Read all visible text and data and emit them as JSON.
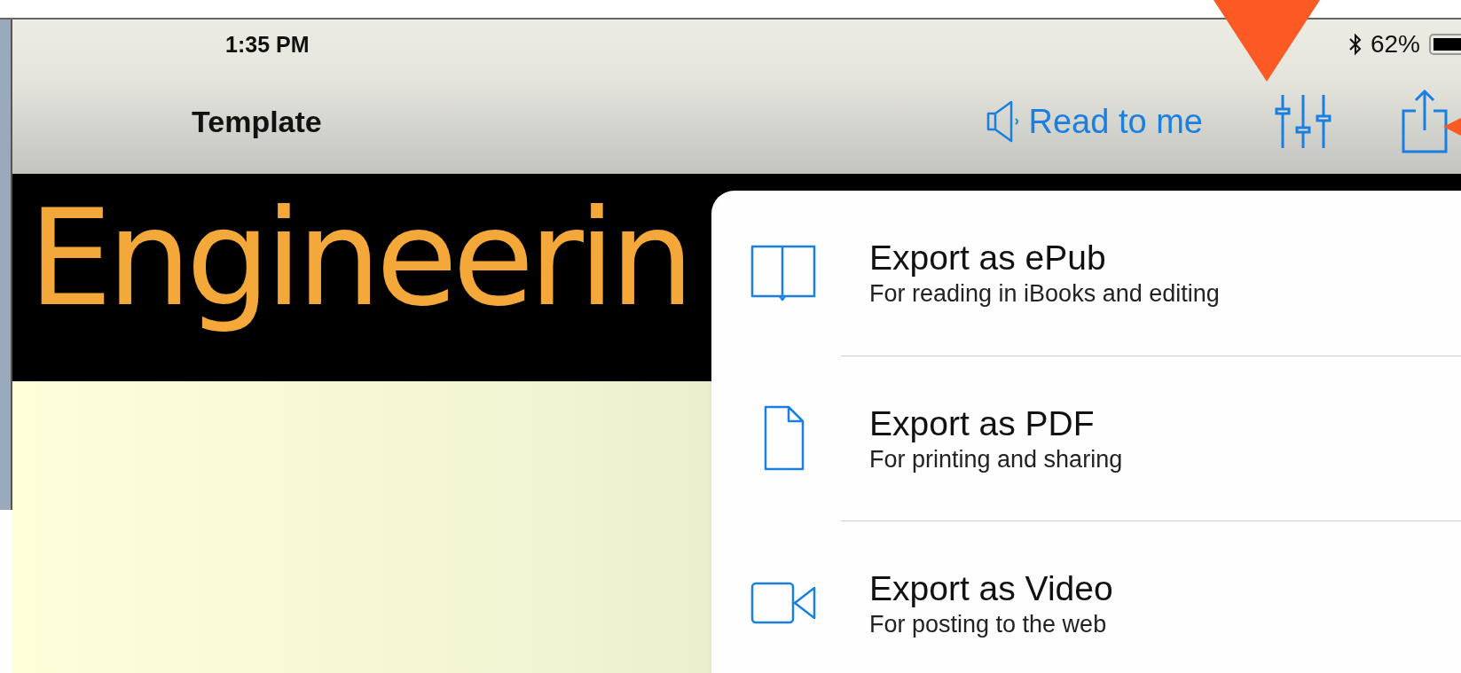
{
  "status_bar": {
    "time": "1:35 PM",
    "battery": "62%"
  },
  "nav_bar": {
    "title": "Template",
    "read_button": "Read to me"
  },
  "banner": {
    "title": "Engineerin"
  },
  "export_menu": {
    "items": [
      {
        "kind": "epub",
        "title": "Export as ePub",
        "subtitle": "For reading in iBooks and editing"
      },
      {
        "kind": "pdf",
        "title": "Export as PDF",
        "subtitle": "For printing and sharing"
      },
      {
        "kind": "video",
        "title": "Export as Video",
        "subtitle": "For posting to the web"
      }
    ]
  }
}
